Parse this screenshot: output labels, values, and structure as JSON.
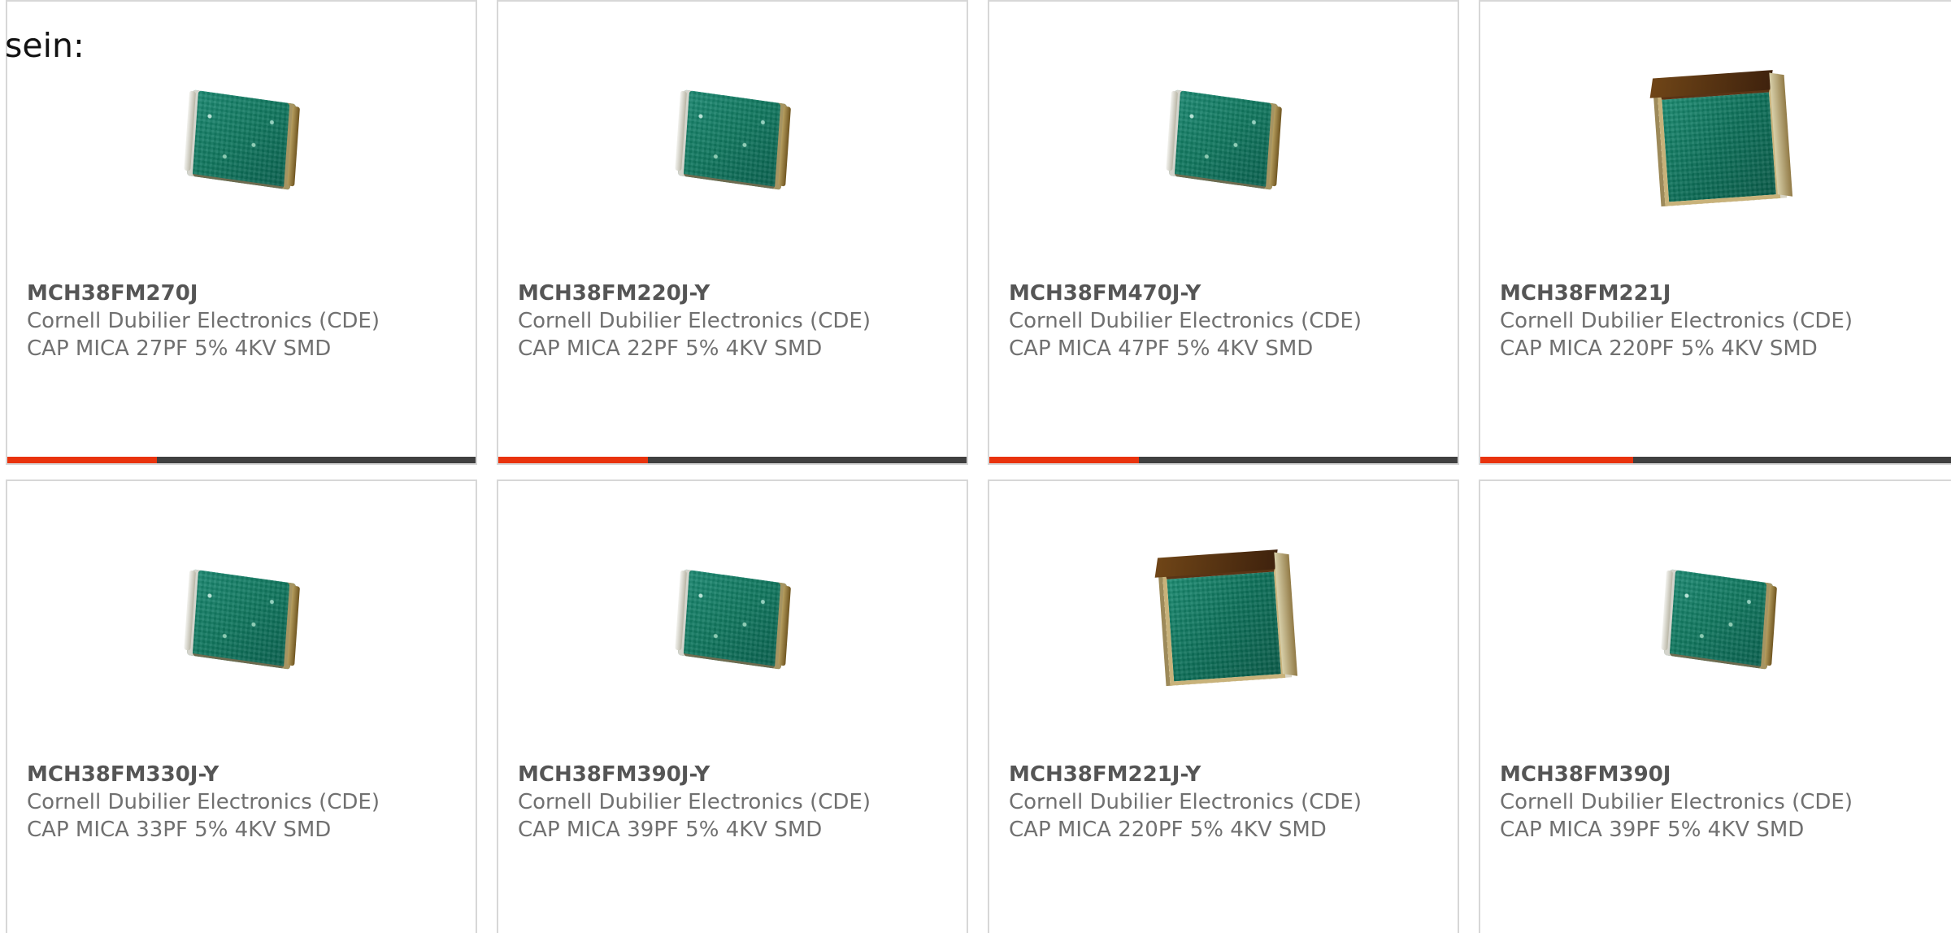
{
  "page": {
    "intro_text": "sein:",
    "accent_color": "#e9330d",
    "bar_color": "#404040"
  },
  "products": [
    {
      "part_number": "MCH38FM270J",
      "manufacturer": "Cornell Dubilier Electronics (CDE)",
      "description": "CAP MICA 27PF 5% 4KV SMD",
      "image_icon": "mica-capacitor-chip-icon",
      "bar_fill_percent": 32
    },
    {
      "part_number": "MCH38FM220J-Y",
      "manufacturer": "Cornell Dubilier Electronics (CDE)",
      "description": "CAP MICA 22PF 5% 4KV SMD",
      "image_icon": "mica-capacitor-chip-icon",
      "bar_fill_percent": 32
    },
    {
      "part_number": "MCH38FM470J-Y",
      "manufacturer": "Cornell Dubilier Electronics (CDE)",
      "description": "CAP MICA 47PF 5% 4KV SMD",
      "image_icon": "mica-capacitor-chip-icon",
      "bar_fill_percent": 32
    },
    {
      "part_number": "MCH38FM221J",
      "manufacturer": "Cornell Dubilier Electronics (CDE)",
      "description": "CAP MICA 220PF 5% 4KV SMD",
      "image_icon": "mica-capacitor-block-icon",
      "bar_fill_percent": 32
    },
    {
      "part_number": "MCH38FM330J-Y",
      "manufacturer": "Cornell Dubilier Electronics (CDE)",
      "description": "CAP MICA 33PF 5% 4KV SMD",
      "image_icon": "mica-capacitor-chip-icon"
    },
    {
      "part_number": "MCH38FM390J-Y",
      "manufacturer": "Cornell Dubilier Electronics (CDE)",
      "description": "CAP MICA 39PF 5% 4KV SMD",
      "image_icon": "mica-capacitor-chip-icon"
    },
    {
      "part_number": "MCH38FM221J-Y",
      "manufacturer": "Cornell Dubilier Electronics (CDE)",
      "description": "CAP MICA 220PF 5% 4KV SMD",
      "image_icon": "mica-capacitor-block-icon"
    },
    {
      "part_number": "MCH38FM390J",
      "manufacturer": "Cornell Dubilier Electronics (CDE)",
      "description": "CAP MICA 39PF 5% 4KV SMD",
      "image_icon": "mica-capacitor-chip-icon"
    }
  ]
}
